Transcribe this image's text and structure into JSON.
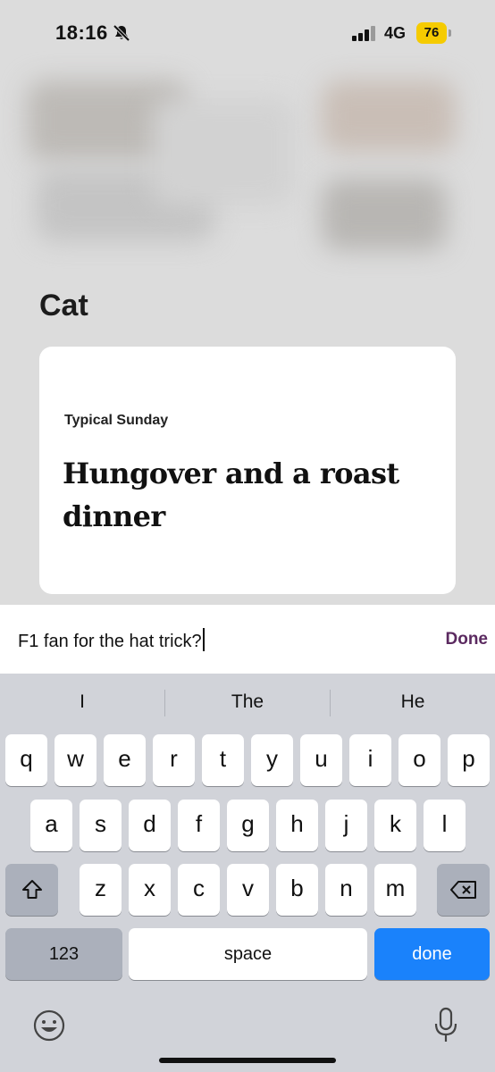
{
  "status_bar": {
    "time": "18:16",
    "network": "4G",
    "battery": "76"
  },
  "profile": {
    "name": "Cat",
    "prompt": {
      "label": "Typical Sunday",
      "answer": "Hungover and a roast dinner"
    }
  },
  "comment_input": {
    "value": "F1 fan for the hat trick?",
    "done_label": "Done"
  },
  "keyboard": {
    "suggestions": [
      "I",
      "The",
      "He"
    ],
    "row1": [
      "q",
      "w",
      "e",
      "r",
      "t",
      "y",
      "u",
      "i",
      "o",
      "p"
    ],
    "row2": [
      "a",
      "s",
      "d",
      "f",
      "g",
      "h",
      "j",
      "k",
      "l"
    ],
    "row3": [
      "z",
      "x",
      "c",
      "v",
      "b",
      "n",
      "m"
    ],
    "numbers_label": "123",
    "space_label": "space",
    "done_label": "done"
  },
  "colors": {
    "accent": "#5b2a60",
    "keyboard_done": "#1a82fb",
    "battery": "#f5cb00"
  }
}
